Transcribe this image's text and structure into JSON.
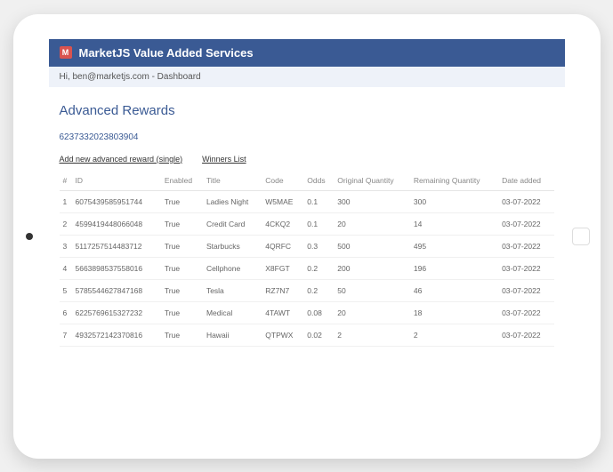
{
  "header": {
    "logo_letter": "M",
    "title": "MarketJS Value Added Services"
  },
  "subheader": {
    "greeting": "Hi, ben@marketjs.com - Dashboard"
  },
  "section": {
    "title": "Advanced Rewards",
    "id": "6237332023803904"
  },
  "links": {
    "add_new": "Add new advanced reward (single)",
    "winners": "Winners List"
  },
  "table": {
    "headers": {
      "num": "#",
      "id": "ID",
      "enabled": "Enabled",
      "title": "Title",
      "code": "Code",
      "odds": "Odds",
      "orig_qty": "Original Quantity",
      "rem_qty": "Remaining Quantity",
      "date": "Date added"
    },
    "rows": [
      {
        "num": "1",
        "id": "6075439585951744",
        "enabled": "True",
        "title": "Ladies Night",
        "code": "W5MAE",
        "odds": "0.1",
        "orig_qty": "300",
        "rem_qty": "300",
        "date": "03-07-2022"
      },
      {
        "num": "2",
        "id": "4599419448066048",
        "enabled": "True",
        "title": "Credit Card",
        "code": "4CKQ2",
        "odds": "0.1",
        "orig_qty": "20",
        "rem_qty": "14",
        "date": "03-07-2022"
      },
      {
        "num": "3",
        "id": "5117257514483712",
        "enabled": "True",
        "title": "Starbucks",
        "code": "4QRFC",
        "odds": "0.3",
        "orig_qty": "500",
        "rem_qty": "495",
        "date": "03-07-2022"
      },
      {
        "num": "4",
        "id": "5663898537558016",
        "enabled": "True",
        "title": "Cellphone",
        "code": "X8FGT",
        "odds": "0.2",
        "orig_qty": "200",
        "rem_qty": "196",
        "date": "03-07-2022"
      },
      {
        "num": "5",
        "id": "5785544627847168",
        "enabled": "True",
        "title": "Tesla",
        "code": "RZ7N7",
        "odds": "0.2",
        "orig_qty": "50",
        "rem_qty": "46",
        "date": "03-07-2022"
      },
      {
        "num": "6",
        "id": "6225769615327232",
        "enabled": "True",
        "title": "Medical",
        "code": "4TAWT",
        "odds": "0.08",
        "orig_qty": "20",
        "rem_qty": "18",
        "date": "03-07-2022"
      },
      {
        "num": "7",
        "id": "4932572142370816",
        "enabled": "True",
        "title": "Hawaii",
        "code": "QTPWX",
        "odds": "0.02",
        "orig_qty": "2",
        "rem_qty": "2",
        "date": "03-07-2022"
      }
    ]
  }
}
